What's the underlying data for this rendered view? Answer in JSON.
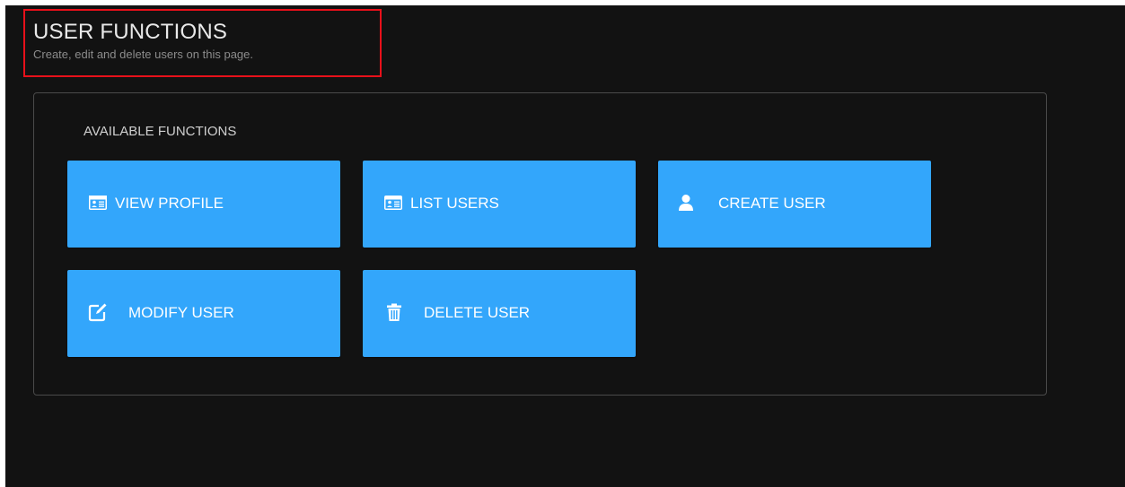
{
  "header": {
    "title": "USER FUNCTIONS",
    "subtitle": "Create, edit and delete users on this page."
  },
  "functions": {
    "heading": "AVAILABLE FUNCTIONS",
    "buttons": [
      {
        "label": "VIEW PROFILE",
        "icon": "id-card-icon"
      },
      {
        "label": "LIST USERS",
        "icon": "id-card-icon"
      },
      {
        "label": "CREATE USER",
        "icon": "user-icon"
      },
      {
        "label": "MODIFY USER",
        "icon": "edit-icon"
      },
      {
        "label": "DELETE USER",
        "icon": "trash-icon"
      }
    ]
  },
  "colors": {
    "background": "#121212",
    "button": "#33a6fb",
    "highlight_border": "#e8101a"
  }
}
